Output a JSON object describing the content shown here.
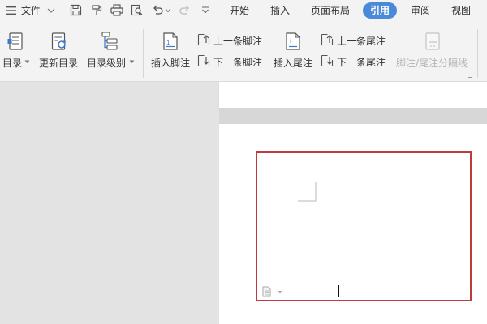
{
  "menubar": {
    "file_label": "文件",
    "tabs": [
      {
        "label": "开始"
      },
      {
        "label": "插入"
      },
      {
        "label": "页面布局"
      },
      {
        "label": "引用",
        "active": true
      },
      {
        "label": "审阅"
      },
      {
        "label": "视图"
      }
    ]
  },
  "ribbon": {
    "toc_label": "目录",
    "update_toc_label": "更新目录",
    "toc_level_label": "目录级别",
    "insert_footnote_label": "插入脚注",
    "prev_footnote_label": "上一条脚注",
    "next_footnote_label": "下一条脚注",
    "insert_endnote_label": "插入尾注",
    "prev_endnote_label": "上一条尾注",
    "next_endnote_label": "下一条尾注",
    "separator_label": "脚注/尾注分隔线"
  },
  "colors": {
    "accent": "#4a8ad9",
    "highlight_border": "#c0393b",
    "icon_blue": "#3c78c8"
  },
  "icons": [
    "hamburger-icon",
    "chevron-down-icon",
    "save-icon",
    "format-painter-icon",
    "print-icon",
    "print-preview-icon",
    "undo-icon",
    "redo-icon",
    "more-icon",
    "toc-icon",
    "update-toc-icon",
    "toc-level-icon",
    "insert-footnote-icon",
    "prev-footnote-icon",
    "next-footnote-icon",
    "insert-endnote-icon",
    "prev-endnote-icon",
    "next-endnote-icon",
    "separator-icon",
    "paste-options-icon"
  ]
}
